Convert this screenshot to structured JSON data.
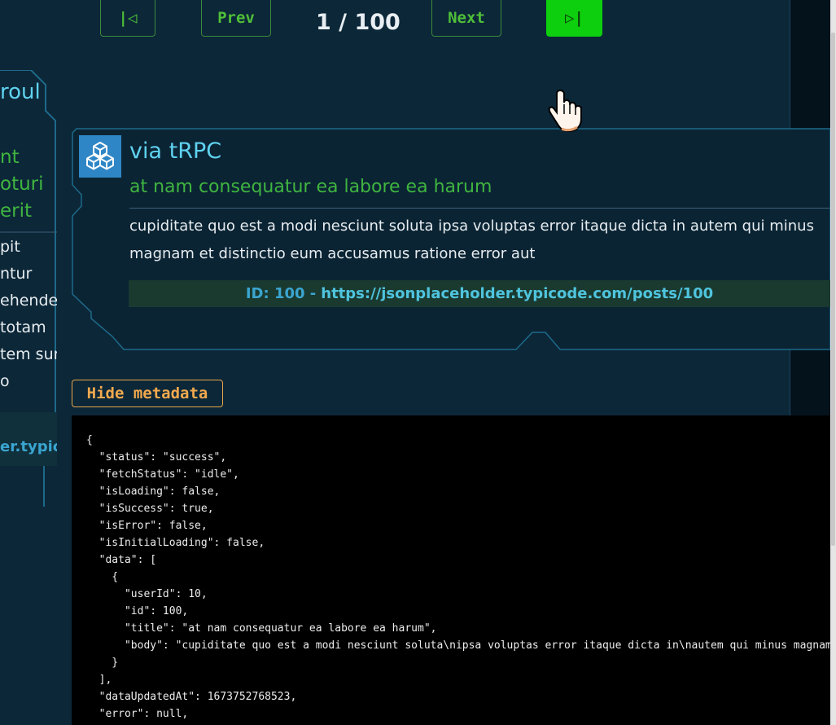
{
  "pagination": {
    "first_label": "|◁",
    "prev_label": "Prev",
    "page_indicator": "1 / 100",
    "next_label": "Next",
    "last_label": "▷|"
  },
  "left_card": {
    "title_fragment": "roul",
    "subtitle_lines": [
      "nt",
      "oturi",
      "erit"
    ],
    "body_lines": [
      "pit",
      "ntur",
      "ehenderi",
      "totam",
      "tem sur",
      "o"
    ],
    "link_fragment": "er.typico"
  },
  "post_card": {
    "source_label": "via tRPC",
    "title": "at nam consequatur ea labore ea harum",
    "body": "cupiditate quo est a modi nesciunt soluta ipsa voluptas error itaque dicta in autem qui minus magnam et distinctio eum accusamus ratione error aut",
    "meta_id": "ID: 100 -",
    "meta_url": "https://jsonplaceholder.typicode.com/posts/100"
  },
  "metadata_toggle_label": "Hide metadata",
  "metadata_json": "{\n  \"status\": \"success\",\n  \"fetchStatus\": \"idle\",\n  \"isLoading\": false,\n  \"isSuccess\": true,\n  \"isError\": false,\n  \"isInitialLoading\": false,\n  \"data\": [\n    {\n      \"userId\": 10,\n      \"id\": 100,\n      \"title\": \"at nam consequatur ea labore ea harum\",\n      \"body\": \"cupiditate quo est a modi nesciunt soluta\\nipsa voluptas error itaque dicta in\\nautem qui minus magnam et distinctio eum\\naccusamus ratione error aut\"\n    }\n  ],\n  \"dataUpdatedAt\": 1673752768523,\n  \"error\": null,",
  "colors": {
    "accent_cyan": "#5fd3f0",
    "accent_green": "#3fb53f",
    "button_active": "#0dcf0d",
    "toggle_orange": "#f2a94e",
    "background": "#0c2738"
  },
  "icons": {
    "card_icon": "cubes-icon",
    "cursor": "hand-pointer-icon"
  }
}
